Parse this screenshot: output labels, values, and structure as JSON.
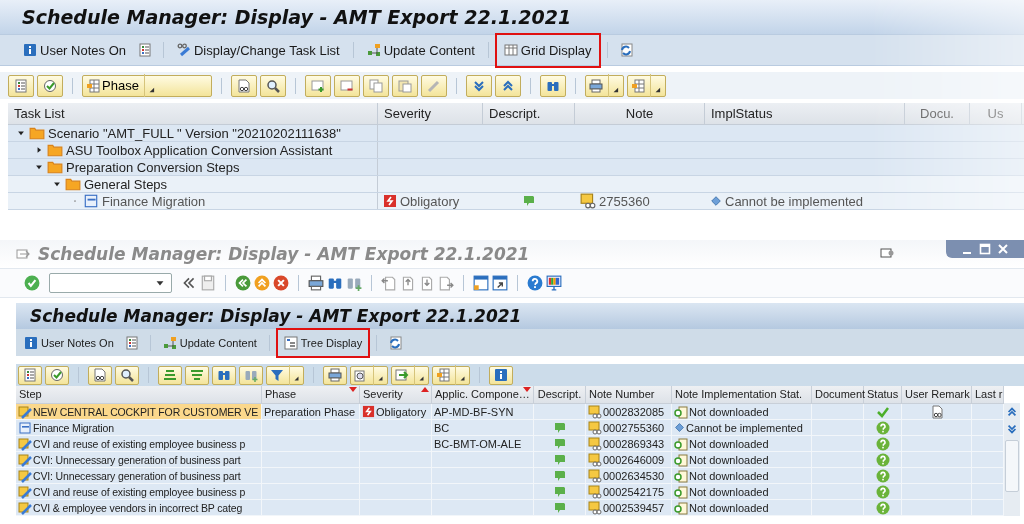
{
  "tree_view": {
    "title": "Schedule Manager: Display - AMT Export 22.1.2021",
    "toolbar": [
      {
        "label": "User Notes On",
        "highlighted": false
      },
      {
        "label": "Display/Change Task List",
        "highlighted": false
      },
      {
        "label": "Update Content",
        "highlighted": false
      },
      {
        "label": "Grid Display",
        "highlighted": true
      }
    ],
    "phase_button": "Phase",
    "columns": [
      "Task List",
      "Severity",
      "Descript.",
      "Note",
      "ImplStatus",
      "Docu.",
      "Us"
    ],
    "tree": [
      {
        "label": "Scenario \"AMT_FULL \" Version \"20210202111638\"",
        "kind": "folder",
        "expanded": true,
        "children": [
          {
            "label": "ASU Toolbox Application Conversion Assistant",
            "kind": "folder",
            "expanded": false
          },
          {
            "label": "Preparation Conversion Steps",
            "kind": "folder",
            "expanded": true,
            "children": [
              {
                "label": "General Steps",
                "kind": "folder",
                "expanded": true,
                "children": [
                  {
                    "label": "Finance Migration",
                    "kind": "task",
                    "severity": "Obligatory",
                    "description": true,
                    "note": "2755360",
                    "impl_status": "Cannot be implemented"
                  }
                ]
              }
            ]
          }
        ]
      }
    ]
  },
  "grid_view": {
    "window_title": "Schedule Manager: Display - AMT Export 22.1.2021",
    "title": "Schedule Manager: Display - AMT Export 22.1.2021",
    "toolbar": [
      {
        "label": "User Notes On",
        "highlighted": false
      },
      {
        "label": "Update Content",
        "highlighted": false
      },
      {
        "label": "Tree Display",
        "highlighted": true
      }
    ],
    "columns": [
      {
        "label": "Step",
        "kind": "plain"
      },
      {
        "label": "Phase",
        "kind": "sort_desc"
      },
      {
        "label": "Severity",
        "kind": "sort_asc"
      },
      {
        "label": "Applic. Compone…",
        "kind": "sort_desc"
      },
      {
        "label": "Descript.",
        "kind": "plain"
      },
      {
        "label": "Note Number",
        "kind": "plain"
      },
      {
        "label": "Note Implementation Stat.",
        "kind": "plain"
      },
      {
        "label": "Document",
        "kind": "plain"
      },
      {
        "label": "Status",
        "kind": "plain"
      },
      {
        "label": "User Remark",
        "kind": "plain"
      },
      {
        "label": "Last r",
        "kind": "plain"
      }
    ],
    "rows": [
      {
        "step": "NEW CENTRAL COCKPIT FOR CUSTOMER VE",
        "kind": "note",
        "selected": true,
        "phase": "Preparation Phase",
        "severity": "Obligatory",
        "component": "AP-MD-BF-SYN",
        "description": false,
        "note_number": "0002832085",
        "impl_status": "Not downloaded",
        "implementable": true,
        "done": true,
        "user_remark": true
      },
      {
        "step": "Finance Migration",
        "kind": "task",
        "selected": false,
        "component": "BC",
        "description": true,
        "note_number": "0002755360",
        "impl_status": "Cannot be implemented",
        "implementable": false,
        "done": false,
        "user_remark": false
      },
      {
        "step": "CVI and reuse of existing employee business p",
        "kind": "note",
        "selected": false,
        "component": "BC-BMT-OM-ALE",
        "description": true,
        "note_number": "0002869343",
        "impl_status": "Not downloaded",
        "implementable": true,
        "done": false,
        "user_remark": false
      },
      {
        "step": "CVI: Unnecessary generation of business part",
        "kind": "note",
        "selected": false,
        "description": true,
        "note_number": "0002646009",
        "impl_status": "Not downloaded",
        "implementable": true,
        "done": false,
        "user_remark": false
      },
      {
        "step": "CVI: Unnecessary generation of business part",
        "kind": "note",
        "selected": false,
        "description": true,
        "note_number": "0002634530",
        "impl_status": "Not downloaded",
        "implementable": true,
        "done": false,
        "user_remark": false
      },
      {
        "step": "CVI and reuse of existing employee business p",
        "kind": "note",
        "selected": false,
        "description": true,
        "note_number": "0002542175",
        "impl_status": "Not downloaded",
        "implementable": true,
        "done": false,
        "user_remark": false
      },
      {
        "step": "CVI & employee vendors in incorrect BP categ",
        "kind": "note",
        "selected": false,
        "description": true,
        "note_number": "0002539457",
        "impl_status": "Not downloaded",
        "implementable": true,
        "done": false,
        "user_remark": false
      }
    ]
  }
}
